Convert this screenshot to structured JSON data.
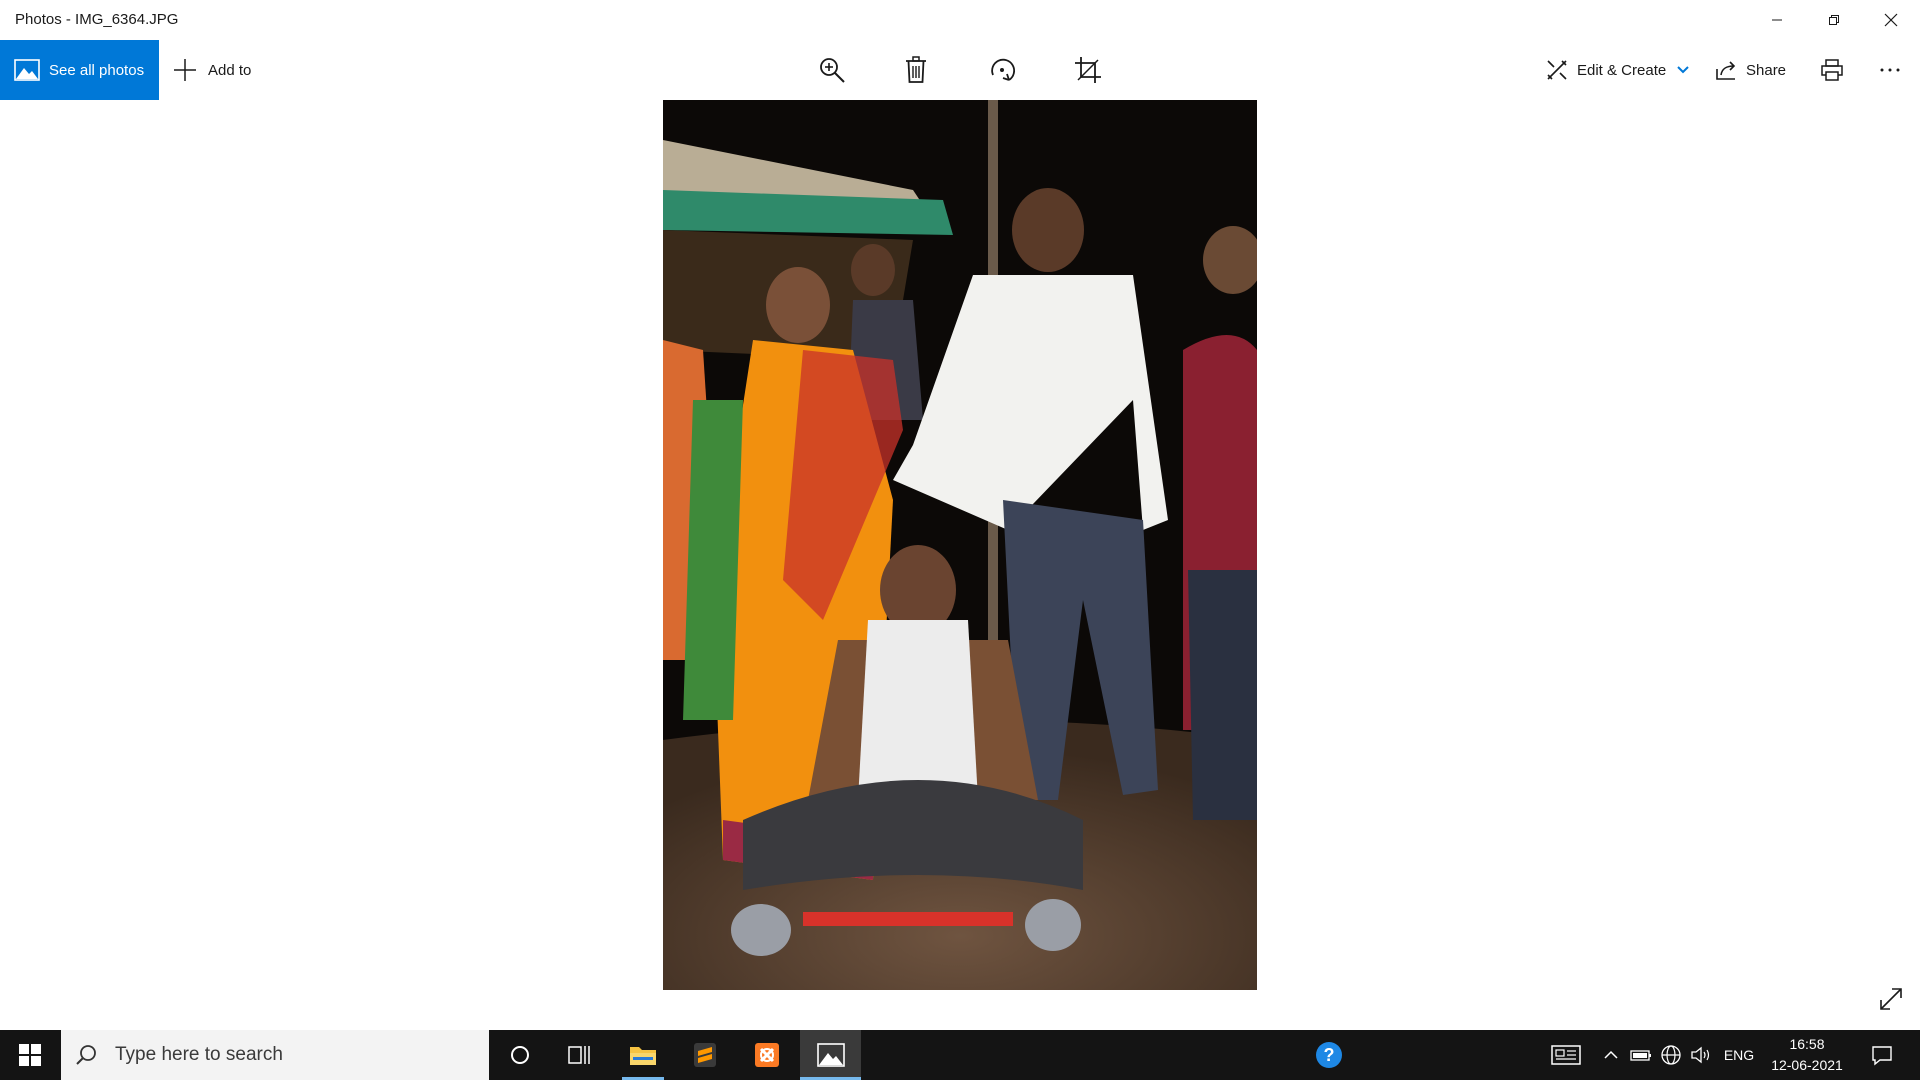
{
  "window": {
    "title": "Photos - IMG_6364.JPG",
    "controls": [
      "minimize-icon",
      "restore-icon",
      "close-icon"
    ]
  },
  "toolbar": {
    "see_all_label": "See all photos",
    "add_to_label": "Add to",
    "center_tools": [
      "zoom-in-icon",
      "delete-icon",
      "rotate-icon",
      "crop-icon"
    ],
    "edit_create_label": "Edit & Create",
    "share_label": "Share",
    "print_icon": "print-icon",
    "more_icon": "more-icon"
  },
  "viewer": {
    "image_name": "IMG_6364.JPG",
    "expand_icon": "expand-icon"
  },
  "taskbar": {
    "search_placeholder": "Type here to search",
    "apps": [
      "cortana-icon",
      "task-view-icon",
      "file-explorer-icon",
      "sublime-text-icon",
      "xampp-icon",
      "photos-icon"
    ],
    "tray": {
      "language": "ENG",
      "time": "16:58",
      "date": "12-06-2021"
    }
  },
  "colors": {
    "accent": "#0078d7",
    "taskbar": "#141414",
    "active_indicator": "#76b9ed"
  }
}
